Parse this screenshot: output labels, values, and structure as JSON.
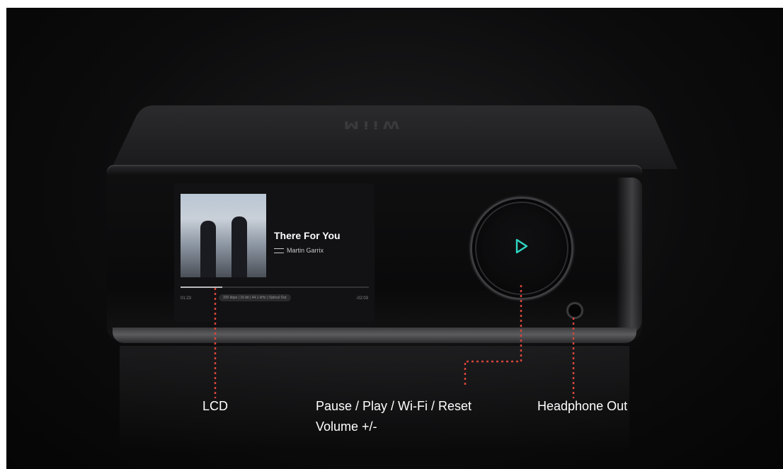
{
  "lcd": {
    "song_title": "There For You",
    "artist": "Martin Garrix",
    "elapsed": "01:23",
    "format": "320 kbps | 16 bit | 44.1 kHz | Optical Out",
    "remaining": "-02:03",
    "progress_fraction": 0.22
  },
  "callouts": {
    "lcd_label": "LCD",
    "knob_label_line1": "Pause / Play / Wi-Fi / Reset",
    "knob_label_line2": "Volume +/-",
    "headphone_label": "Headphone Out"
  },
  "colors": {
    "play_icon": "#2fd6c4",
    "callout_line": "#d9453b"
  }
}
